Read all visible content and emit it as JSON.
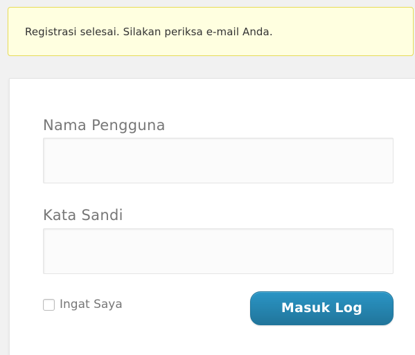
{
  "notice": {
    "message": "Registrasi selesai. Silakan periksa e-mail Anda."
  },
  "login_form": {
    "username_label": "Nama Pengguna",
    "username_value": "",
    "password_label": "Kata Sandi",
    "password_value": "",
    "remember_label": "Ingat Saya",
    "remember_checked": false,
    "submit_label": "Masuk Log"
  },
  "colors": {
    "notice_background": "#ffffe0",
    "notice_border": "#e6db55",
    "button_primary": "#21759b",
    "label_text": "#777777"
  }
}
